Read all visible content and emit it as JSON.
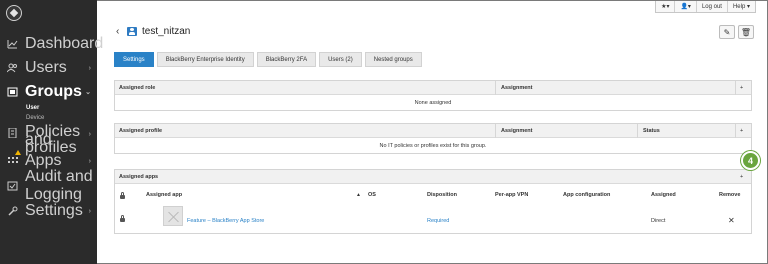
{
  "sidebar": {
    "items": [
      {
        "label": "Dashboard",
        "icon": "dashboard-icon"
      },
      {
        "label": "Users",
        "icon": "users-icon",
        "chevron": "›"
      },
      {
        "label": "Groups",
        "icon": "groups-icon",
        "chevron": "⌄",
        "active": true
      },
      {
        "label": "Policies and",
        "label2": "profiles",
        "icon": "policies-icon",
        "chevron": "›"
      },
      {
        "label": "Apps",
        "icon": "apps-icon",
        "chevron": "›"
      },
      {
        "label": "Audit and Logging",
        "icon": "audit-icon"
      },
      {
        "label": "Settings",
        "icon": "settings-icon",
        "chevron": "›"
      }
    ],
    "sub_items": [
      "User",
      "Device"
    ]
  },
  "topbar": {
    "favorites": "★▾",
    "user": "👤▾",
    "logout": "Log out",
    "help": "Help ▾"
  },
  "header": {
    "back": "‹",
    "title": "test_nitzan",
    "edit_icon": "✎",
    "delete_icon": "🗑"
  },
  "tabs": [
    "Settings",
    "BlackBerry Enterprise Identity",
    "BlackBerry 2FA",
    "Users (2)",
    "Nested groups"
  ],
  "roles_panel": {
    "col1": "Assigned role",
    "col2": "Assignment",
    "empty": "None assigned",
    "add": "+"
  },
  "profiles_panel": {
    "col1": "Assigned profile",
    "col2": "Assignment",
    "col3": "Status",
    "empty": "No IT policies or profiles exist for this group.",
    "add": "+"
  },
  "apps_panel": {
    "title": "Assigned apps",
    "add": "+",
    "columns": {
      "app": "Assigned app",
      "sort": "▲",
      "os": "OS",
      "disposition": "Disposition",
      "vpn": "Per-app VPN",
      "config": "App configuration",
      "assigned": "Assigned",
      "remove": "Remove"
    },
    "row": {
      "name": "Feature – BlackBerry App Store",
      "disposition": "Required",
      "assigned": "Direct",
      "remove": "✕"
    }
  },
  "callout": "4",
  "colors": {
    "accent": "#2a82c7",
    "sidebar": "#2b2b2b",
    "callout": "#6aa53e"
  }
}
